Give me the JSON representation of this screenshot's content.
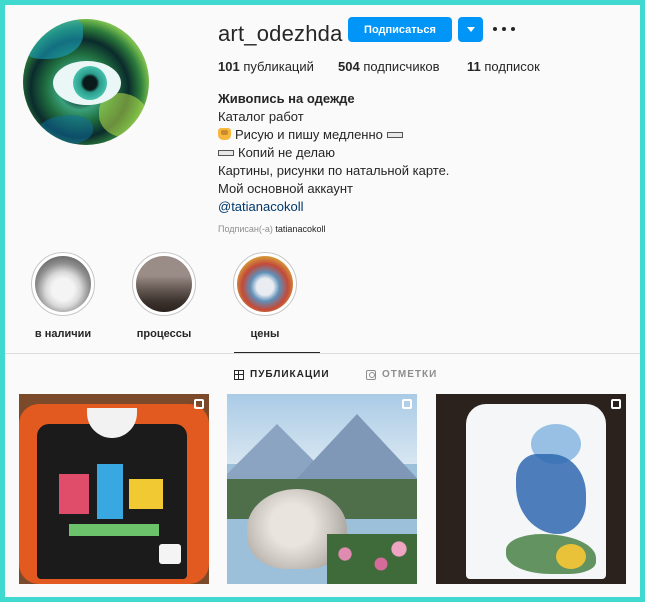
{
  "profile": {
    "username": "art_odezhda",
    "follow_label": "Подписаться",
    "avatar_icon": "avatar-eye-painting"
  },
  "stats": {
    "posts_count": "101",
    "posts_label": "публикаций",
    "followers_count": "504",
    "followers_label": "подписчиков",
    "following_count": "11",
    "following_label": "подписок"
  },
  "bio": {
    "name": "Живопись на одежде",
    "line1": "Каталог работ",
    "line2": "Рисую и пишу медленно",
    "line3": "Копий не делаю",
    "line4": "Картины, рисунки по натальной карте.",
    "line5": "Мой основной аккаунт",
    "link": "@tatianacokoll"
  },
  "followed_by": {
    "prefix": "Подписан(-а)",
    "user": "tatianacokoll"
  },
  "highlights": [
    {
      "label": "в наличии"
    },
    {
      "label": "процессы"
    },
    {
      "label": "цены"
    }
  ],
  "tabs": {
    "posts": "ПУБЛИКАЦИИ",
    "tagged": "ОТМЕТКИ"
  },
  "colors": {
    "accent": "#0095f6",
    "frame_border": "#3fd9d0",
    "background": "#fafafa",
    "link": "#00376b"
  }
}
